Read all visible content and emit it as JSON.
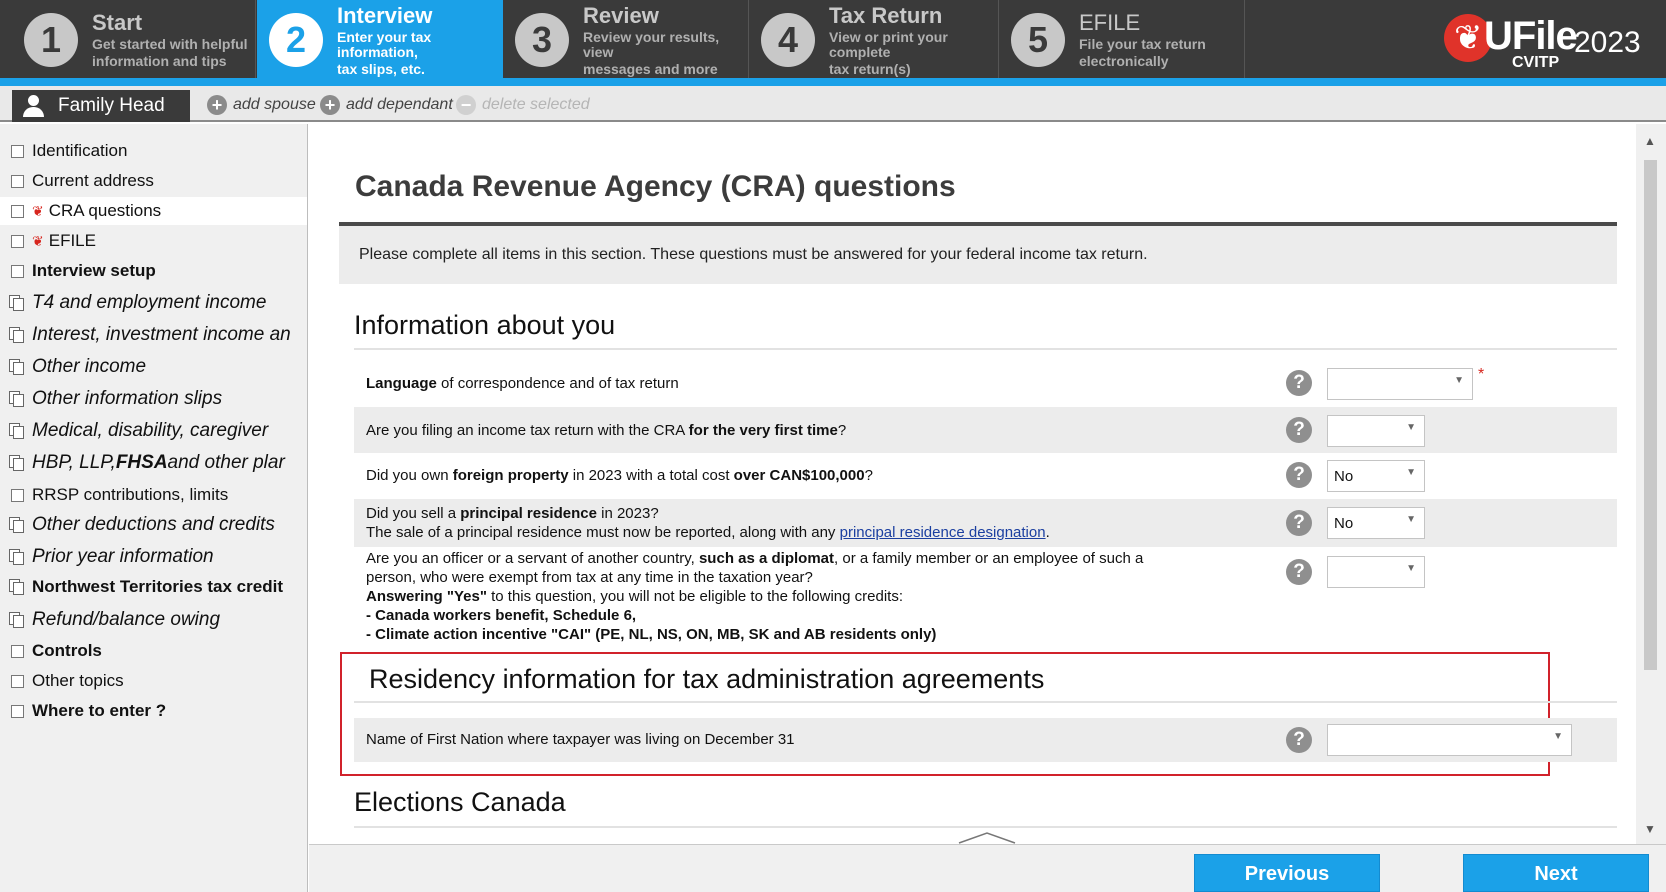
{
  "steps": [
    {
      "num": "1",
      "title": "Start",
      "sub1": "Get started with helpful",
      "sub2": "information and tips"
    },
    {
      "num": "2",
      "title": "Interview",
      "sub1": "Enter your tax information,",
      "sub2": "tax slips, etc."
    },
    {
      "num": "3",
      "title": "Review",
      "sub1": "Review your results, view",
      "sub2": "messages and more"
    },
    {
      "num": "4",
      "title": "Tax Return",
      "sub1": "View or print your complete",
      "sub2": "tax return(s)"
    },
    {
      "num": "5",
      "title": "EFILE",
      "sub1": "File your tax return",
      "sub2": "electronically"
    }
  ],
  "logo": {
    "brand": "UFile",
    "year": "2023",
    "edition": "CVITP"
  },
  "family": {
    "tab_label": "Family Head",
    "add_spouse": "add spouse",
    "add_dependant": "add dependant",
    "delete_selected": "delete selected"
  },
  "sidebar": {
    "items": [
      {
        "label": "Identification"
      },
      {
        "label": "Current address"
      },
      {
        "label": "CRA questions"
      },
      {
        "label": "EFILE"
      },
      {
        "label": "Interview setup"
      },
      {
        "label": "T4 and employment income"
      },
      {
        "label": "Interest, investment income an"
      },
      {
        "label": "Other income"
      },
      {
        "label": "Other information slips"
      },
      {
        "label": "Medical, disability, caregiver"
      },
      {
        "label": "HBP, LLP, ",
        "label_bold": "FHSA",
        "label_tail": " and other plar"
      },
      {
        "label": "RRSP contributions, limits"
      },
      {
        "label": "Other deductions and credits"
      },
      {
        "label": "Prior year information"
      },
      {
        "label": "Northwest Territories tax credit"
      },
      {
        "label": "Refund/balance owing"
      },
      {
        "label": "Controls"
      },
      {
        "label": "Other topics"
      },
      {
        "label": "Where to enter ?"
      }
    ]
  },
  "main": {
    "title": "Canada Revenue Agency (CRA) questions",
    "intro": "Please complete all items in this section. These questions must be answered for your federal income tax return.",
    "section_you": "Information about you",
    "q_language": {
      "b": "Language",
      "t": " of correspondence and of tax return",
      "value": "",
      "required": "*"
    },
    "q_first_time": {
      "t1": "Are you filing an income tax return with the CRA ",
      "b": "for the very first time",
      "t2": "?",
      "value": ""
    },
    "q_foreign": {
      "t1": "Did you own ",
      "b1": "foreign property",
      "t2": " in 2023 with a total cost ",
      "b2": "over CAN$100,000",
      "t3": "?",
      "value": "No"
    },
    "q_principal": {
      "t1": "Did you sell a ",
      "b": "principal residence",
      "t2": " in 2023?",
      "line2": "The sale of a principal residence must now be reported, along with any ",
      "link": "principal residence designation",
      "dot": ".",
      "value": "No"
    },
    "q_officer": {
      "t1": "Are you an officer or a servant of another country, ",
      "b1": "such as a diplomat",
      "t2": ", or a family member or an employee of such a",
      "line2": "person, who were exempt from tax at any time in the taxation year?",
      "b3": "Answering \"Yes\"",
      "line3": " to this question, you will not be eligible to the following credits:",
      "line4": "- Canada workers benefit, Schedule 6,",
      "line5": "- Climate action incentive \"CAI\" (PE, NL, NS, ON, MB, SK and AB residents only)",
      "value": ""
    },
    "section_residency": "Residency information for tax administration agreements",
    "q_first_nation": {
      "t": "Name of First Nation where taxpayer was living on December 31",
      "value": ""
    },
    "section_elections": "Elections Canada",
    "help_glyph": "?"
  },
  "footer": {
    "previous": "Previous",
    "next": "Next"
  },
  "colors": {
    "accent": "#1ba1e8",
    "dark": "#3a3a3a",
    "highlight": "#d1222b",
    "required": "#d7261e"
  }
}
